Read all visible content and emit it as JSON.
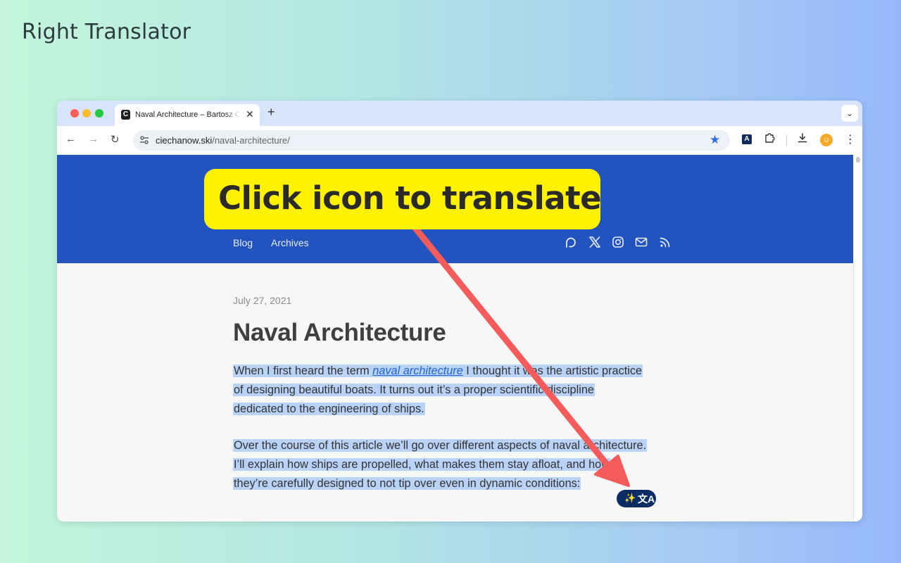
{
  "promo": {
    "title": "Right Translator"
  },
  "callout": {
    "text": "Click icon to translate"
  },
  "browser": {
    "tab": {
      "favicon": "C",
      "title": "Naval Architecture – Bartosz Ciechanowski",
      "close": "✕"
    },
    "new_tab": "+",
    "tab_menu": "⌄",
    "toolbar": {
      "back": "←",
      "forward": "→",
      "reload": "↻",
      "url_host": "ciechanow.ski",
      "url_path": "/naval-architecture/",
      "bookmark": "★",
      "translator_ext": "A",
      "extensions": "⧉",
      "download": "⤓",
      "avatar": "☺",
      "menu": "⋮"
    }
  },
  "site": {
    "nav": [
      "Blog",
      "Archives"
    ],
    "social_icons": [
      "patreon-icon",
      "x-icon",
      "instagram-icon",
      "mail-icon",
      "rss-icon"
    ]
  },
  "post": {
    "date": "July 27, 2021",
    "title": "Naval Architecture",
    "p1": {
      "l1_before": "When I first heard the term ",
      "link": "naval architecture",
      "l1_after": " I thought it was the artistic practice",
      "l2": "of designing beautiful boats. It turns out it’s a proper scientific discipline",
      "l3": "dedicated to the engineering of ships."
    },
    "p2": {
      "l1": "Over the course of this article we’ll go over different aspects of naval architecture.",
      "l2": "I’ll explain how ships are propelled, what makes them stay afloat, and how",
      "l3": "they’re carefully designed to not tip over even in dynamic conditions:"
    }
  },
  "translate_chip": {
    "wand": "✨",
    "translate": "文A"
  },
  "colors": {
    "callout": "#fff200",
    "arrow": "#f45b5b",
    "header": "#2253bf",
    "selection": "#b8d3f7",
    "chip": "#0c2d64",
    "link": "#1f63d6"
  }
}
